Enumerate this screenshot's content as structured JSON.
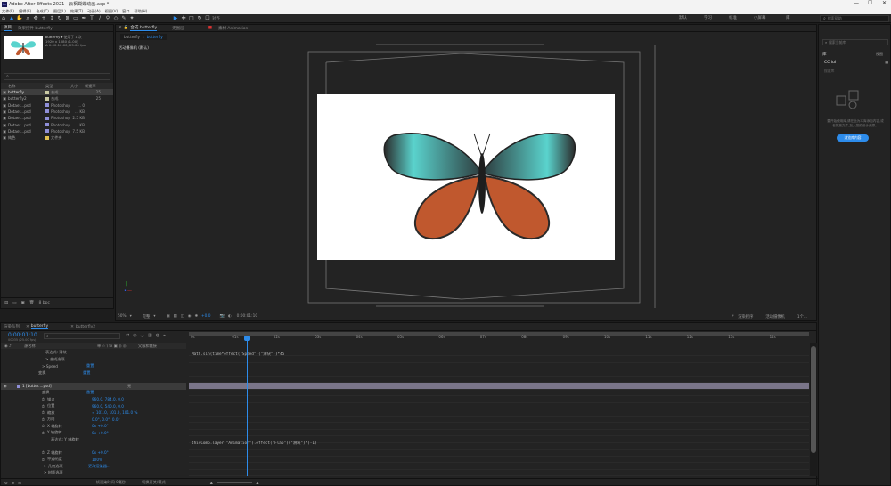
{
  "window": {
    "title": "Adobe After Effects 2021 - 云枫蝴蝶动画.aep *",
    "minimize": "—",
    "maximize": "☐",
    "close": "✕"
  },
  "menu": [
    "文件(F)",
    "编辑(E)",
    "合成(C)",
    "图层(L)",
    "效果(T)",
    "动画(A)",
    "视图(V)",
    "窗口",
    "帮助(H)"
  ],
  "toolbar": {
    "snap_label": "对齐",
    "workspaces": [
      "默认",
      "学习",
      "标准",
      "小屏幕",
      "库"
    ],
    "search_placeholder": "搜索帮助"
  },
  "project": {
    "tabs": [
      "项目",
      "效果控件 butterfly"
    ],
    "preview": {
      "name": "butterfly ▾",
      "used": "使用了 1 次",
      "size": "1920 x 1080 (1.00)",
      "duration": "Δ 0:00:10:00, 25.00 fps"
    },
    "search_placeholder": "",
    "columns": [
      "名称",
      "类型",
      "大小",
      "帧速率"
    ],
    "items": [
      {
        "name": "butterfly",
        "type": "合成",
        "size": "",
        "fps": "25",
        "color": "#c9c9a3",
        "selected": true
      },
      {
        "name": "butterfly2",
        "type": "合成",
        "size": "",
        "fps": "25",
        "color": "#c9c9a3",
        "selected": false
      },
      {
        "name": "Dotaet...psd",
        "type": "Photoshop",
        "size": "... 0",
        "fps": "",
        "color": "#8f8fd8",
        "selected": false
      },
      {
        "name": "Dotaet...psd",
        "type": "Photoshop",
        "size": "... KB",
        "fps": "",
        "color": "#8f8fd8",
        "selected": false
      },
      {
        "name": "Dotaet...psd",
        "type": "Photoshop",
        "size": "2.5 KB",
        "fps": "",
        "color": "#8f8fd8",
        "selected": false
      },
      {
        "name": "Dotaet...psd",
        "type": "Photoshop",
        "size": "... KB",
        "fps": "",
        "color": "#8f8fd8",
        "selected": false
      },
      {
        "name": "Dotaet...psd",
        "type": "Photoshop",
        "size": "7.5 KB",
        "fps": "",
        "color": "#8f8fd8",
        "selected": false
      },
      {
        "name": "纯色",
        "type": "文件夹",
        "size": "",
        "fps": "",
        "color": "#e0c050",
        "selected": false
      }
    ],
    "bpc": "8 bpc"
  },
  "composition": {
    "tabs": [
      "合成 butterfly",
      "无图层",
      "素材 Animation"
    ],
    "breadcrumb": [
      "butterfly",
      "butterfly"
    ],
    "camera_label": "活动摄像机 (默认)",
    "footer": {
      "zoom": "50%",
      "resolution": "完整",
      "exposure": "+0.0",
      "timecode": "0:00:01:10",
      "renderer": "渲染程序",
      "camera": "活动摄像机",
      "views": "1个..."
    }
  },
  "timeline": {
    "tabs": [
      "渲染队列",
      "butterfly",
      "butterfly2"
    ],
    "timecode": "0:00:01:10",
    "frame_info": "00035 (25.00 fps)",
    "search_placeholder": "",
    "columns": [
      "源名称",
      "单 ☆ \\ fx ▣ ◎ ◎",
      "父级和链接"
    ],
    "ruler": [
      "0s",
      "01s",
      "02s",
      "03s",
      "04s",
      "05s",
      "06s",
      "07s",
      "08s",
      "09s",
      "10s",
      "11s",
      "12s",
      "13s",
      "14s"
    ],
    "layers": [
      {
        "label": "表达式: 滑块",
        "value": "",
        "link": ""
      },
      {
        "label": "> 合成选项",
        "value": "",
        "link": ""
      },
      {
        "label": "> Speed",
        "value": "重置",
        "link": ""
      },
      {
        "label": "变换",
        "value": "重置",
        "link": ""
      },
      {
        "label": "",
        "value": "",
        "link": ""
      },
      {
        "label": "1  [butter....psd]",
        "value": "",
        "link": "无"
      },
      {
        "label": "变换",
        "value": "重置",
        "link": ""
      },
      {
        "label": "锚点",
        "value": "960.0, 784.0, 0.0",
        "link": ""
      },
      {
        "label": "位置",
        "value": "960.0, 540.0, 0.0",
        "link": ""
      },
      {
        "label": "缩放",
        "value": "∞ 101.0, 101.0, 101.0 %",
        "link": ""
      },
      {
        "label": "方向",
        "value": "0.0°, 0.0°, 0.0°",
        "link": ""
      },
      {
        "label": "X 轴旋转",
        "value": "0x +0.0°",
        "link": ""
      },
      {
        "label": "Y 轴旋转",
        "value": "0x +0.0°",
        "link": ""
      },
      {
        "label": "表达式: Y 轴旋转",
        "value": "",
        "link": ""
      },
      {
        "label": "",
        "value": "",
        "link": ""
      },
      {
        "label": "Z 轴旋转",
        "value": "0x +0.0°",
        "link": ""
      },
      {
        "label": "不透明度",
        "value": "100%",
        "link": ""
      },
      {
        "label": "> 几何选项",
        "value": "更改渲染器...",
        "link": ""
      },
      {
        "label": "> 材质选项",
        "value": "",
        "link": ""
      }
    ],
    "expressions": [
      "Math.sin(time*effect(\"Speed\")(\"滑块\"))*45",
      "thisComp.layer(\"Animation\").effect(\"Flap\")(\"滑块\")*(-1)"
    ],
    "footer": {
      "mode": "切换开关/模式",
      "render_time": "帧渲染时间 0毫秒"
    }
  },
  "right": {
    "search_placeholder": "搜索帮助",
    "library_search": "搜索当前库",
    "library_tab": "库",
    "library_name": "CC lui",
    "view_mode": "视图",
    "tree_label": "搜索库",
    "empty_text": "要开始使用库,请在此为本库添加内容,或者拖放文件,加入您的设计资源。",
    "button": "浏览库内容"
  },
  "colors": {
    "accent": "#2d8ceb",
    "butterfly_teal": "#5ad3cd",
    "butterfly_orange": "#c0582e"
  }
}
